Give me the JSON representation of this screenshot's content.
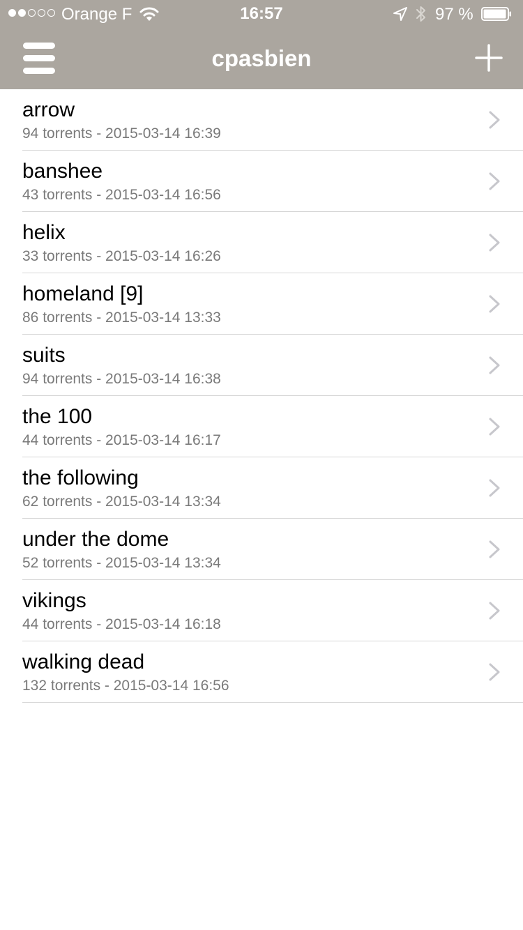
{
  "status_bar": {
    "signal_dots": [
      true,
      true,
      false,
      false,
      false
    ],
    "carrier": "Orange F",
    "time": "16:57",
    "battery_pct": "97 %",
    "battery_level": 0.97
  },
  "navbar": {
    "title": "cpasbien",
    "menu_icon": "hamburger-menu-icon",
    "add_icon": "plus-icon"
  },
  "shows": [
    {
      "title": "arrow",
      "subtitle": "94 torrents - 2015-03-14 16:39"
    },
    {
      "title": "banshee",
      "subtitle": "43 torrents - 2015-03-14 16:56"
    },
    {
      "title": "helix",
      "subtitle": "33 torrents - 2015-03-14 16:26"
    },
    {
      "title": "homeland [9]",
      "subtitle": "86 torrents - 2015-03-14 13:33"
    },
    {
      "title": "suits",
      "subtitle": "94 torrents - 2015-03-14 16:38"
    },
    {
      "title": "the 100",
      "subtitle": "44 torrents - 2015-03-14 16:17"
    },
    {
      "title": "the following",
      "subtitle": "62 torrents - 2015-03-14 13:34"
    },
    {
      "title": "under the dome",
      "subtitle": "52 torrents - 2015-03-14 13:34"
    },
    {
      "title": "vikings",
      "subtitle": "44 torrents - 2015-03-14 16:18"
    },
    {
      "title": "walking dead",
      "subtitle": "132 torrents - 2015-03-14 16:56"
    }
  ],
  "colors": {
    "header_bg": "#aba69f",
    "separator": "#d6d6d6",
    "subtitle": "#7a7a7a",
    "chevron": "#c7c7cc"
  }
}
